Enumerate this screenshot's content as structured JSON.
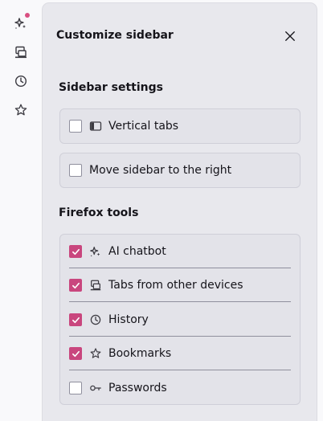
{
  "colors": {
    "accent": "#c9467e",
    "notification_dot": "#d94f81",
    "icon": "#3b3a41"
  },
  "rail": {
    "items": [
      {
        "name": "ai-chatbot",
        "icon": "sparkles-icon",
        "notification": true
      },
      {
        "name": "synced-tabs",
        "icon": "synced-tabs-icon"
      },
      {
        "name": "history",
        "icon": "clock-icon"
      },
      {
        "name": "bookmarks",
        "icon": "star-icon"
      }
    ]
  },
  "panel": {
    "title": "Customize sidebar",
    "close_icon": "close-icon",
    "sidebar_settings": {
      "title": "Sidebar settings",
      "vertical_tabs": {
        "label": "Vertical tabs",
        "checked": false,
        "icon": "vertical-tabs-icon"
      },
      "move_right": {
        "label": "Move sidebar to the right",
        "checked": false
      }
    },
    "firefox_tools": {
      "title": "Firefox tools",
      "items": [
        {
          "label": "AI chatbot",
          "checked": true,
          "icon": "sparkles-icon"
        },
        {
          "label": "Tabs from other devices",
          "checked": true,
          "icon": "synced-tabs-icon"
        },
        {
          "label": "History",
          "checked": true,
          "icon": "clock-icon"
        },
        {
          "label": "Bookmarks",
          "checked": true,
          "icon": "star-icon"
        },
        {
          "label": "Passwords",
          "checked": false,
          "icon": "key-icon"
        }
      ]
    }
  }
}
